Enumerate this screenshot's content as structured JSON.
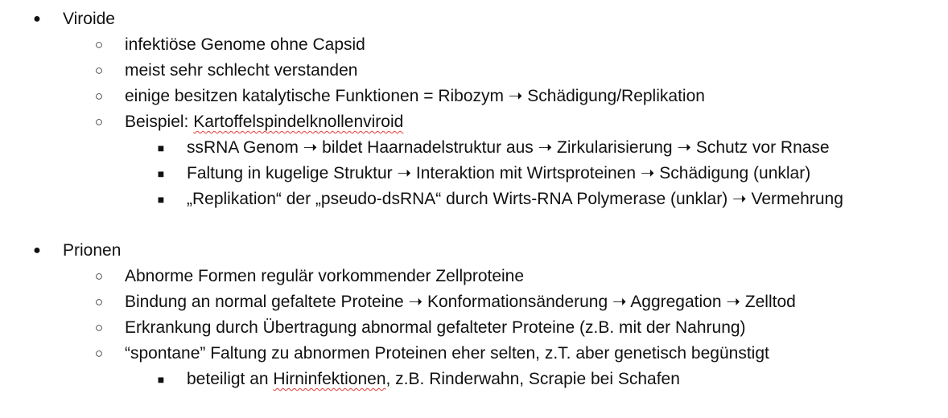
{
  "bullets": {
    "level1": "●",
    "level2": "○",
    "level3": "■"
  },
  "spellcheck_color": "#e53935",
  "sections": [
    {
      "title": "Viroide",
      "items": [
        {
          "text": "infektiöse Genome ohne Capsid"
        },
        {
          "text": "meist sehr schlecht verstanden"
        },
        {
          "text": "einige besitzen katalytische Funktionen = Ribozym ➝ Schädigung/Replikation"
        },
        {
          "prefix": "Beispiel: ",
          "misspelled": "Kartoffelspindelknollenviroid",
          "subitems": [
            {
              "text": "ssRNA Genom ➝ bildet Haarnadelstruktur aus ➝ Zirkularisierung ➝ Schutz vor Rnase"
            },
            {
              "text": "Faltung in kugelige Struktur ➝ Interaktion mit Wirtsproteinen ➝ Schädigung (unklar)"
            },
            {
              "text": "„Replikation“ der „pseudo-dsRNA“ durch Wirts-RNA Polymerase (unklar) ➝ Vermehrung"
            }
          ]
        }
      ]
    },
    {
      "title": "Prionen",
      "items": [
        {
          "text": "Abnorme Formen regulär vorkommender Zellproteine"
        },
        {
          "text": "Bindung an normal gefaltete Proteine ➝ Konformationsänderung ➝ Aggregation ➝ Zelltod"
        },
        {
          "text": "Erkrankung durch Übertragung abnormal gefalteter Proteine (z.B. mit der Nahrung)"
        },
        {
          "text": "“spontane” Faltung zu abnormen Proteinen eher selten, z.T. aber genetisch begünstigt",
          "subitems": [
            {
              "prefix": "beteiligt an ",
              "misspelled": "Hirninfektionen",
              "suffix": ", z.B. Rinderwahn, Scrapie bei Schafen"
            }
          ]
        }
      ]
    }
  ]
}
